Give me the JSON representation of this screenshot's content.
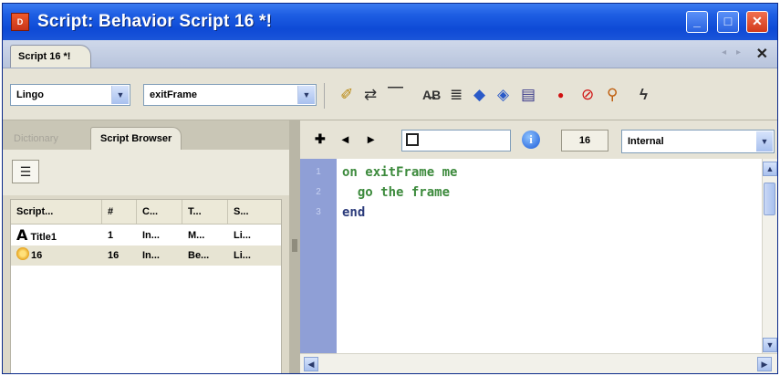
{
  "window": {
    "title": "Script: Behavior Script 16 *!",
    "app_icon_label": "D",
    "buttons": {
      "minimize": "_",
      "maximize": "□",
      "close": "✕"
    }
  },
  "doc_tabs": {
    "active_tab": "Script 16 *!",
    "close": "✕",
    "nav": "◂ ▸"
  },
  "toolbar": {
    "language_select": {
      "selected": "Lingo",
      "arrow": "▼"
    },
    "handler_select": {
      "selected": "exitFrame",
      "arrow": "▼"
    },
    "icons": [
      "go-to-handler-icon",
      "comment-icon",
      "uncomment-icon",
      "alphabetical-lingo-icon",
      "categorized-lingo-icon",
      "scripting-objects-icon",
      "3d-lingo-icon",
      "scripting-xtras-icon",
      "toggle-breakpoint-icon",
      "ignore-breakpoints-icon",
      "watch-expression-icon",
      "recompile-icon"
    ]
  },
  "left_panel": {
    "tabs": [
      "Dictionary",
      "Script Browser"
    ],
    "list_view_icon": "☰",
    "table": {
      "columns": [
        "Script...",
        "#",
        "C...",
        "T...",
        "S..."
      ],
      "rows": [
        {
          "icon": "A",
          "script": "Title1",
          "num": "1",
          "c": "In...",
          "t": "M...",
          "s": "Li..."
        },
        {
          "icon": "",
          "script": "16",
          "num": "16",
          "c": "In...",
          "t": "Be...",
          "s": "Li..."
        }
      ]
    }
  },
  "script_panel": {
    "nav": {
      "new": "✚",
      "back": "◂",
      "forward": "▸"
    },
    "info_label": "i",
    "cast_member_number": "16",
    "cast_select": {
      "selected": "Internal",
      "arrow": "▼"
    },
    "lines": [
      {
        "number": "1",
        "keyword": "on",
        "rest": " exitFrame me"
      },
      {
        "number": "2",
        "indent": "  ",
        "text": "go the frame"
      },
      {
        "number": "3",
        "keyword": "end"
      }
    ],
    "scroll": {
      "up": "▲",
      "down": "▼",
      "left": "◀",
      "right": "▶"
    }
  },
  "colors": {
    "titlebar": "#1e5ee3",
    "gutter": "#8f9fd6",
    "code_keyword": "#2a3a7a",
    "code_green": "#3c8a3c"
  }
}
